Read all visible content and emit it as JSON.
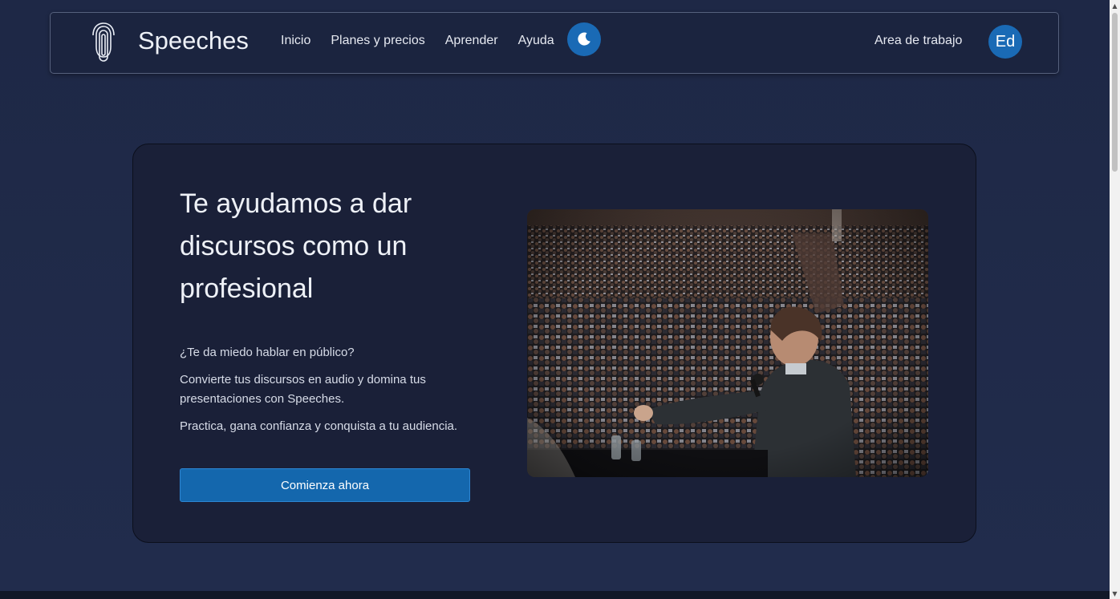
{
  "nav": {
    "brand": "Speeches",
    "links": [
      "Inicio",
      "Planes y precios",
      "Aprender",
      "Ayuda"
    ],
    "workspace": "Area de trabajo",
    "avatar_initials": "Ed",
    "theme_icon": "moon-icon",
    "logo_icon": "microphone-icon"
  },
  "hero": {
    "title": "Te ayudamos a dar discursos como un profesional",
    "question": "¿Te da miedo hablar en público?",
    "paragraph1": "Convierte tus discursos en audio y domina tus presentaciones con Speeches.",
    "paragraph2": "Practica, gana confianza y conquista a tu audiencia.",
    "cta": "Comienza ahora",
    "image_subject": "speaker-facing-audience"
  },
  "colors": {
    "background": "#1f2a48",
    "navbar": "#1b243f",
    "card": "#1a2038",
    "accent": "#1a6ab5",
    "button": "#1467ad"
  }
}
